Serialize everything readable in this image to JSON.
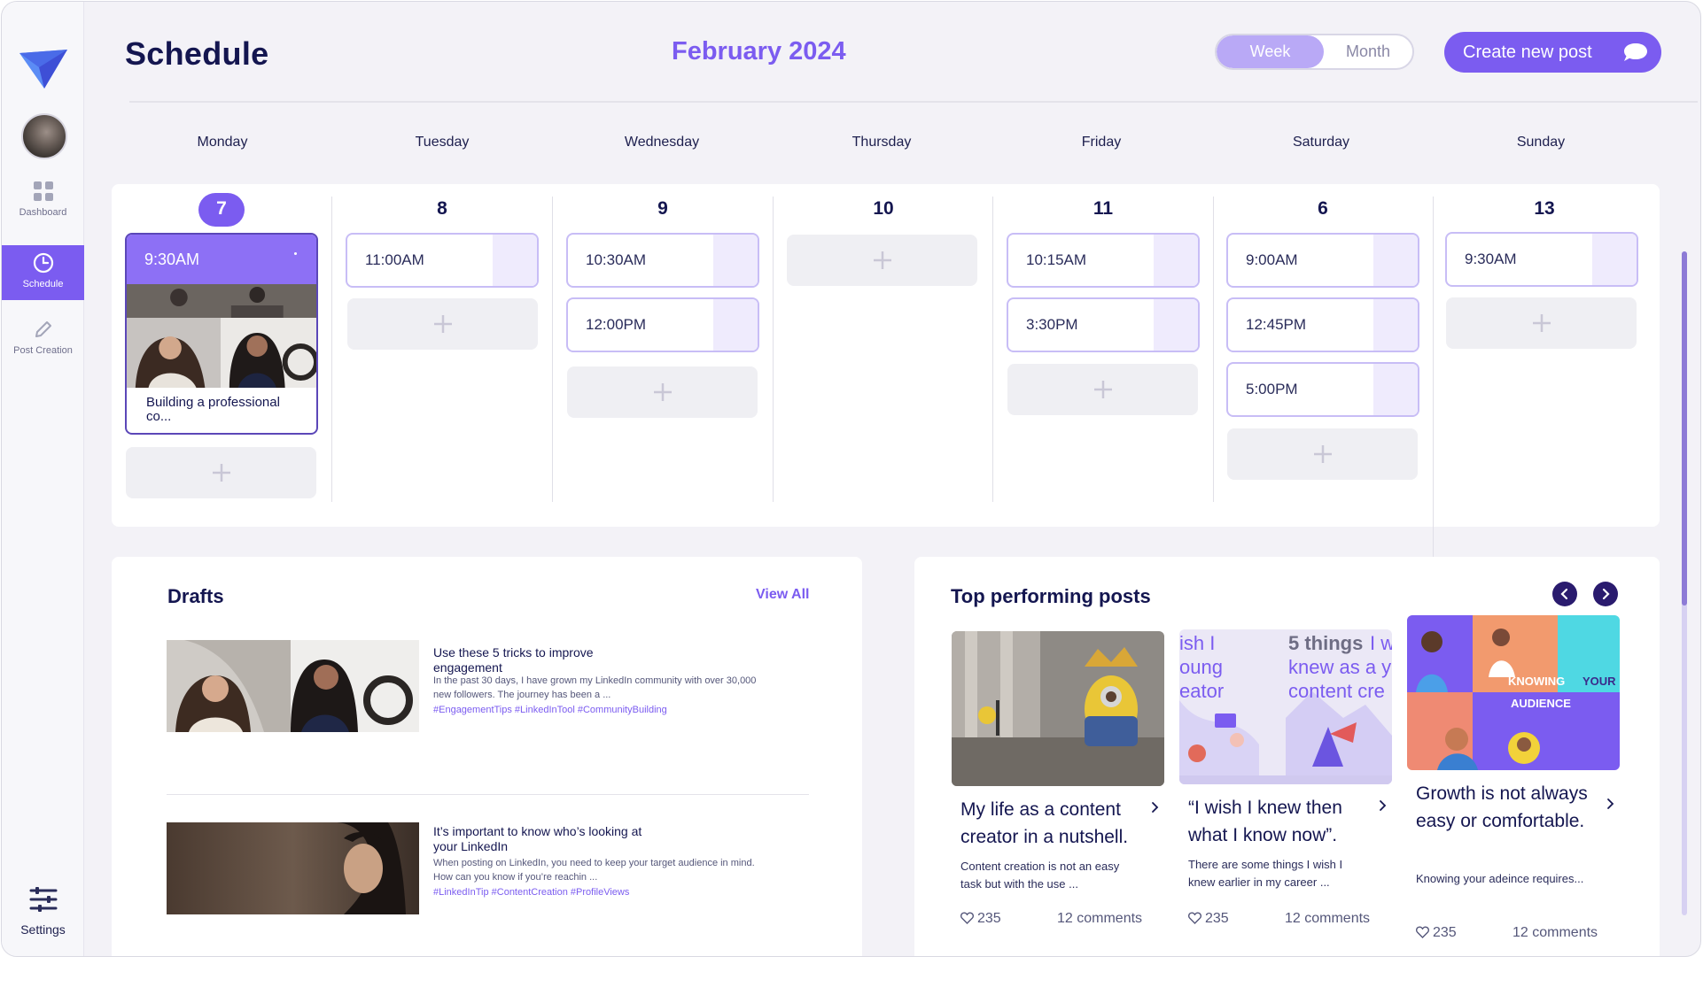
{
  "sidebar": {
    "items": [
      {
        "label": "Dashboard",
        "icon": "grid-icon"
      },
      {
        "label": "Schedule",
        "icon": "clock-icon"
      },
      {
        "label": "Post Creation",
        "icon": "pencil-icon"
      }
    ],
    "settings_label": "Settings"
  },
  "header": {
    "title": "Schedule",
    "month": "February 2024",
    "view_week": "Week",
    "view_month": "Month",
    "create_label": "Create new post"
  },
  "days": [
    {
      "name": "Monday",
      "num": "7"
    },
    {
      "name": "Tuesday",
      "num": "8"
    },
    {
      "name": "Wednesday",
      "num": "9"
    },
    {
      "name": "Thursday",
      "num": "10"
    },
    {
      "name": "Friday",
      "num": "11"
    },
    {
      "name": "Saturday",
      "num": "6"
    },
    {
      "name": "Sunday",
      "num": "13"
    }
  ],
  "schedule": {
    "featured": {
      "time": "9:30AM",
      "caption": "Building a professional co..."
    },
    "tuesday": [
      "11:00AM"
    ],
    "wednesday": [
      "10:30AM",
      "12:00PM"
    ],
    "friday": [
      "10:15AM",
      "3:30PM"
    ],
    "saturday": [
      "9:00AM",
      "12:45PM",
      "5:00PM"
    ],
    "sunday": [
      "9:30AM"
    ]
  },
  "drafts": {
    "title": "Drafts",
    "view_all": "View All",
    "items": [
      {
        "title": "Use these 5 tricks to improve engagement",
        "body": "In the past 30 days, I have grown my LinkedIn community with over 30,000 new followers. The journey has been a ...",
        "tags": "#EngagementTips #LinkedInTool #CommunityBuilding"
      },
      {
        "title": "It’s important to know who’s looking at your LinkedIn",
        "body": "When posting on LinkedIn, you need to keep your target audience in mind. How can you know if you’re reachin ...",
        "tags": "#LinkedInTip #ContentCreation #ProfileViews"
      }
    ]
  },
  "top_posts": {
    "title": "Top performing posts",
    "cards": [
      {
        "title": "My life as a content creator in a nutshell.",
        "desc": "Content creation is not an easy task but with the use ...",
        "likes": "235",
        "comments": "12 comments"
      },
      {
        "title": "“I wish I knew then what I know now”.",
        "desc": "There are some things I wish I knew earlier in my career ...",
        "likes": "235",
        "comments": "12 comments",
        "image_text_left": "ish I\noung\neator",
        "image_text_right_bold": "5 things",
        "image_text_right": "I w\nknew as a y\ncontent cre"
      },
      {
        "title": "Growth is not always easy or comfortable.",
        "desc": "Knowing your adeince requires...",
        "likes": "235",
        "comments": "12 comments",
        "image_text_1": "KNOWING",
        "image_text_2": "YOUR",
        "image_text_3": "AUDIENCE"
      }
    ]
  },
  "colors": {
    "accent": "#7b5cf0",
    "navy": "#141650",
    "panel": "#ffffff",
    "bg": "#f3f2f7"
  }
}
